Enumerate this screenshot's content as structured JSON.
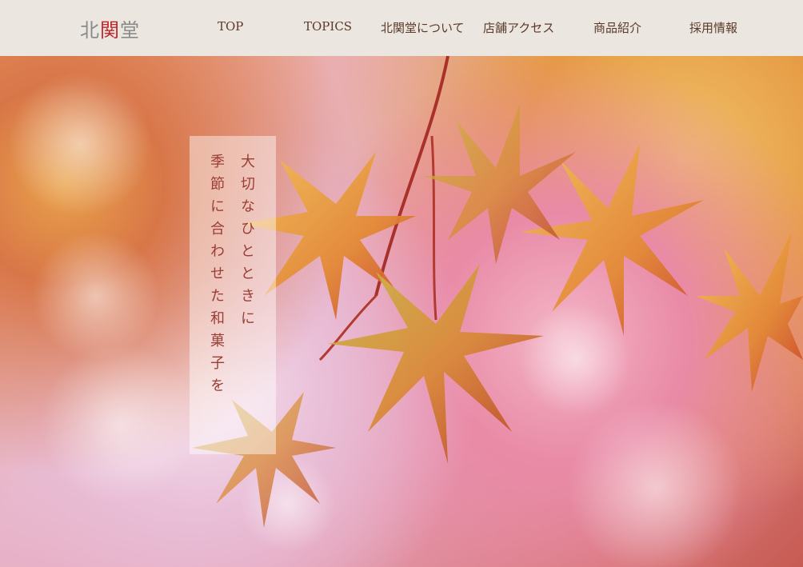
{
  "header": {
    "logo": {
      "part1": "北",
      "part2": "関",
      "part3": "堂"
    },
    "nav": [
      "TOP",
      "TOPICS",
      "北関堂について",
      "店舗アクセス",
      "商品紹介",
      "採用情報"
    ]
  },
  "hero": {
    "caption_lines": [
      "大切なひとときに",
      "季節に合わせた和菓子を"
    ],
    "image_description": "autumn maple leaves"
  },
  "colors": {
    "header_bg": "#ebe6df",
    "logo_accent": "#c0262a",
    "nav_text": "#5b3a2a",
    "caption_text": "#9b3d35"
  }
}
